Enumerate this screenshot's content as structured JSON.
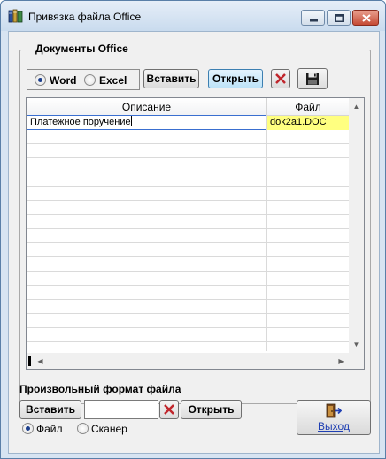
{
  "window": {
    "title": "Привязка файла Office",
    "icon": "books-icon"
  },
  "office_group": {
    "title": "Документы Office",
    "doc_type": {
      "options": [
        {
          "label": "Word",
          "selected": true
        },
        {
          "label": "Excel",
          "selected": false
        }
      ]
    },
    "insert_label": "Вставить",
    "open_label": "Открыть",
    "delete_icon": "red-x-icon",
    "save_icon": "floppy-disk-icon"
  },
  "grid": {
    "columns": [
      "Описание",
      "Файл"
    ],
    "rows": [
      {
        "description": "Платежное поручение",
        "file": "dok2a1.DOC"
      }
    ],
    "empty_rows": 16
  },
  "free_format": {
    "title": "Произвольный формат файла",
    "insert_label": "Вставить",
    "input_value": "",
    "clear_icon": "red-x-icon",
    "open_label": "Открыть",
    "source": {
      "options": [
        {
          "label": "Файл",
          "selected": true
        },
        {
          "label": "Сканер",
          "selected": false
        }
      ]
    }
  },
  "exit": {
    "label": "Выход",
    "icon": "exit-door-icon"
  },
  "colors": {
    "title_bar": "#c9dbee",
    "file_cell_highlight": "#ffff80",
    "close_button": "#c54a34",
    "exit_link": "#1f3fb3",
    "delete_x": "#c0262c"
  }
}
